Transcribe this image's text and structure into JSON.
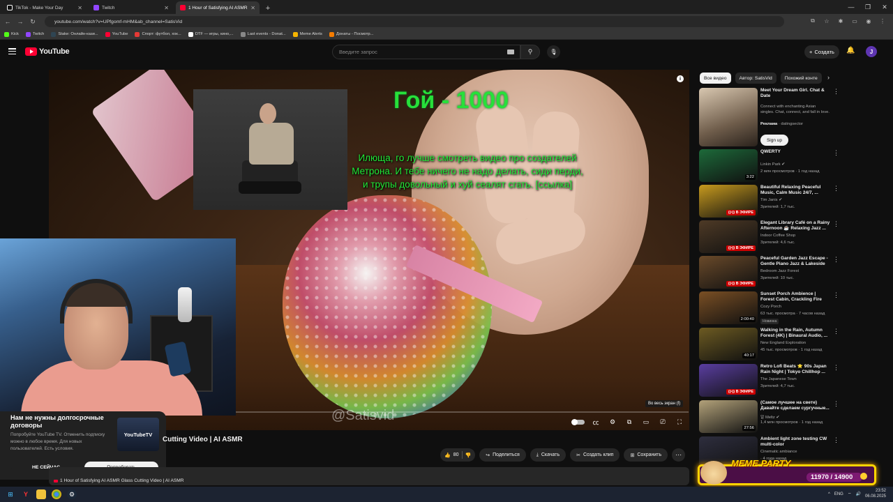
{
  "browser": {
    "tabs": [
      {
        "title": "TikTok - Make Your Day",
        "favicon_color": "#111111",
        "active": false
      },
      {
        "title": "Twitch",
        "favicon_color": "#9146ff",
        "active": false
      },
      {
        "title": "1 Hour of Satisfying AI ASMR G",
        "favicon_color": "#ff0033",
        "active": true
      }
    ],
    "url": "youtube.com/watch?v=UPfgomf-mHM&ab_channel=SatisVid",
    "bookmarks": [
      {
        "label": "Kick",
        "color": "#53fc18"
      },
      {
        "label": "Twitch",
        "color": "#9146ff"
      },
      {
        "label": "Stake: Онлайн-кази...",
        "color": "#1a2c38"
      },
      {
        "label": "YouTube",
        "color": "#ff0033"
      },
      {
        "label": "Спорт: футбол, хок...",
        "color": "#e53935"
      },
      {
        "label": "DTF — игры, кино,...",
        "color": "#ffffff"
      },
      {
        "label": "Last events - Donat...",
        "color": "#888888"
      },
      {
        "label": "Meme Alerts",
        "color": "#f5b400"
      },
      {
        "label": "Донаты - Посмотр...",
        "color": "#f57c00"
      }
    ]
  },
  "youtube": {
    "logo_text": "YouTube",
    "search_placeholder": "Введите запрос",
    "create_label": "Создать",
    "avatar_letter": "J"
  },
  "player": {
    "caption_title": "Гой - 1000",
    "caption_text": "Илюща, го лучше смотреть видео про создателей Метрона. И тебе ничего не надо делать, сиди перди, и трупы довольный и хуй сеалят сгать. [ссылка]",
    "watermark": "@Satisvid",
    "fullscreen_tooltip": "Во весь экран (f)"
  },
  "video": {
    "title_visible": "Cutting Video | AI ASMR",
    "like_count": "80",
    "share_label": "Поделиться",
    "download_label": "Скачать",
    "clip_label": "Создать клип",
    "save_label": "Сохранить",
    "description_title": "1 Hour of Satisfying AI ASMR Glass Cutting Video | AI ASMR"
  },
  "popup": {
    "title": "Нам не нужны долгосрочные договоры",
    "text": "Попробуйте YouTube TV. Отменить подписку можно в любое время. Для новых пользователей. Есть условия.",
    "thumb_label": "YouTubeTV",
    "dismiss_label": "НЕ СЕЙЧАС",
    "try_label": "Попробовать"
  },
  "sidebar": {
    "chips": [
      "Все видео",
      "Автор: SatisVid",
      "Похожий конте"
    ],
    "ad": {
      "title": "Meet Your Dream Girl. Chat & Date",
      "description": "Connect with enchanting Asian singles. Chat, connect, and fall in love.",
      "ad_label": "Реклама",
      "domain": "· datingsector",
      "cta": "Sign up"
    },
    "recommendations": [
      {
        "title": "QWERTY",
        "channel": "Linkin Park ✔",
        "meta": "2 млн просмотров · 1 год назад",
        "duration": "3:22",
        "live": false,
        "badge": "",
        "thumb": "#1d6a3a"
      },
      {
        "title": "Beautiful Relaxing Peaceful Music, Calm Music 24/7, ...",
        "channel": "Tim Janis ✔",
        "meta": "Зрителей: 1,7 тыс.",
        "duration": "",
        "live": true,
        "badge": "",
        "thumb": "#c79a1e"
      },
      {
        "title": "Elegant Library Café on a Rainy Afternoon ☕ Relaxing Jazz ...",
        "channel": "Indoor Coffee Shop",
        "meta": "Зрителей: 4,6 тыс.",
        "duration": "",
        "live": true,
        "badge": "",
        "thumb": "#4e3a26"
      },
      {
        "title": "Peaceful Garden Jazz Escape - Gentle Piano Jazz & Lakeside ...",
        "channel": "Bedroom Jazz Forest",
        "meta": "Зрителей: 10 тыс.",
        "duration": "",
        "live": true,
        "badge": "",
        "thumb": "#6a4a2a"
      },
      {
        "title": "Sunset Porch Ambience | Forest Cabin, Crackling Fire Pit, Lake ...",
        "channel": "Cozy Porch",
        "meta": "63 тыс. просмотра · 7 часов назад",
        "duration": "2:00:40",
        "live": false,
        "badge": "Новинка",
        "thumb": "#7a4f24"
      },
      {
        "title": "Walking in the Rain, Autumn Forest (4K) | Binaural Audio, ...",
        "channel": "New England Exploration",
        "meta": "45 тыс. просмотров · 1 год назад",
        "duration": "40:17",
        "live": false,
        "badge": "",
        "thumb": "#6d5b22"
      },
      {
        "title": "Retro Lofi Beats ⭐ 90s Japan Rain Night | Tokyo Chillhop ...",
        "channel": "The Japanese Town",
        "meta": "Зрителей: 4,7 тыс.",
        "duration": "",
        "live": true,
        "badge": "",
        "thumb": "#5a3ea0"
      },
      {
        "title": "(Самое лучшее на свете) Давайте сделаем сургучные...",
        "channel": "알 Meltz ✔",
        "meta": "1,4 млн просмотров · 1 год назад",
        "duration": "27:56",
        "live": false,
        "badge": "",
        "thumb": "#b3a27a"
      },
      {
        "title": "Ambient light zone testing CW multi-color",
        "channel": "Cinematic ambiance",
        "meta": "· 4 года назад",
        "duration": "",
        "live": false,
        "badge": "",
        "thumb": "#2e2e3e"
      }
    ],
    "live_label": "((•)) В ЭФИРЕ"
  },
  "meme_widget": {
    "title": "MEME PARTY",
    "score": "11970 / 14900"
  },
  "taskbar": {
    "lang": "ENG",
    "time": "23:52",
    "date": "06.08.2025"
  }
}
